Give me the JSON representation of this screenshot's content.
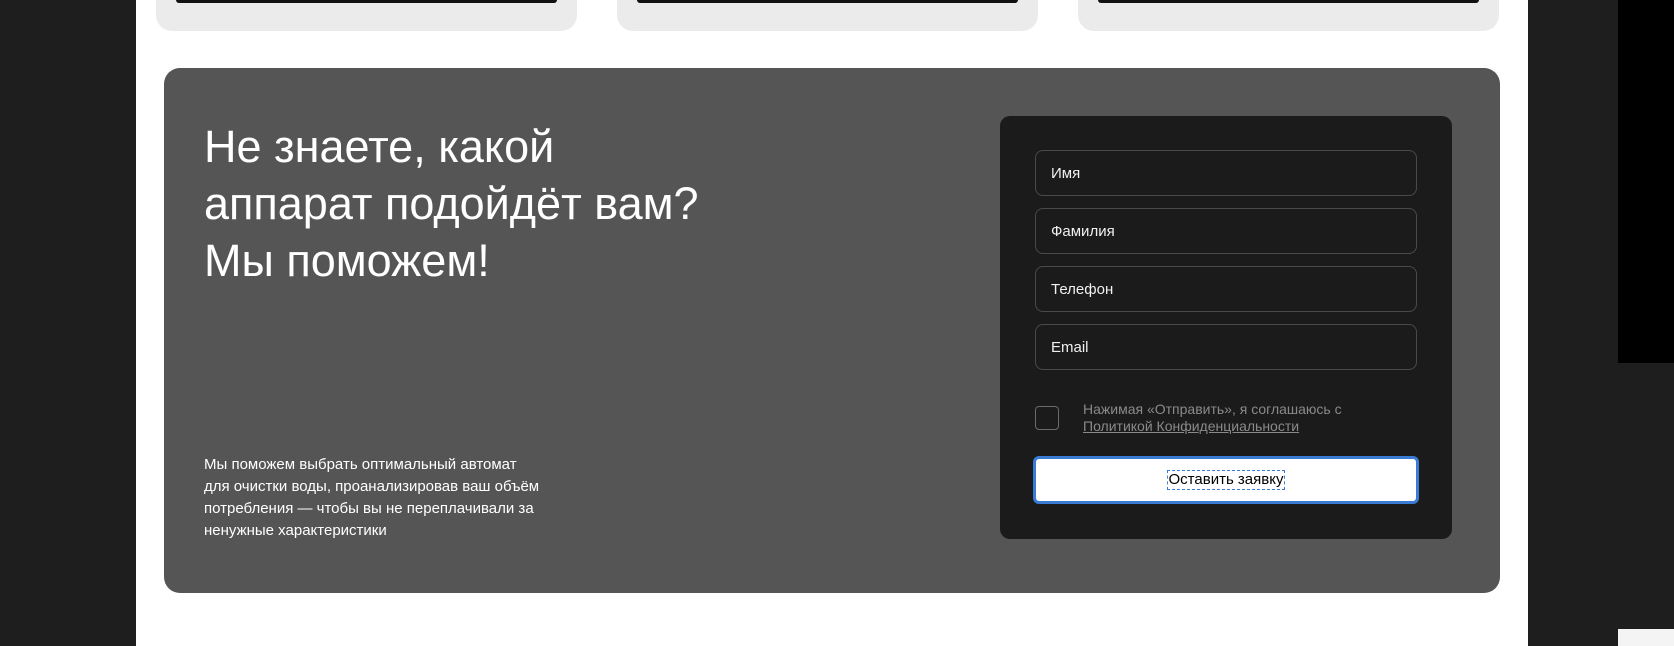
{
  "cta": {
    "title_lines": [
      "Не знаете, какой",
      "аппарат подойдёт вам?",
      "Мы поможем!"
    ],
    "description_lines": [
      "Мы поможем выбрать оптимальный автомат",
      "для очистки воды, проанализировав ваш объём",
      "потребления — чтобы вы не переплачивали за",
      "ненужные характеристики"
    ]
  },
  "form": {
    "fields": [
      {
        "name": "first-name",
        "placeholder": "Имя"
      },
      {
        "name": "last-name",
        "placeholder": "Фамилия"
      },
      {
        "name": "phone",
        "placeholder": "Телефон"
      },
      {
        "name": "email",
        "placeholder": "Email"
      }
    ],
    "consent": {
      "text": "Нажимая «Отправить», я соглашаюсь с",
      "link": "Политикой Конфиденциальности"
    },
    "submit_label": "Оставить заявку"
  },
  "colors": {
    "page_background": "#1e1e1e",
    "cta_background": "#555555",
    "form_background": "#1b1b1b",
    "focus_accent": "#3a7bd5"
  }
}
